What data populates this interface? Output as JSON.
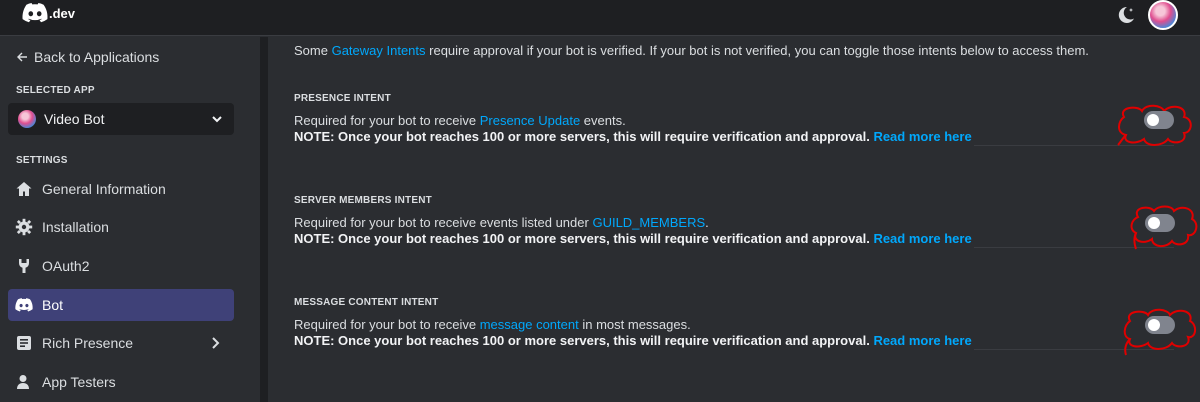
{
  "header": {
    "logo_text": ".dev"
  },
  "sidebar": {
    "back_label": "Back to Applications",
    "selected_app_title": "SELECTED APP",
    "selected_app_name": "Video Bot",
    "settings_title": "SETTINGS",
    "items": [
      {
        "label": "General Information",
        "icon": "home-icon"
      },
      {
        "label": "Installation",
        "icon": "gear-icon"
      },
      {
        "label": "OAuth2",
        "icon": "wrench-icon"
      },
      {
        "label": "Bot",
        "icon": "discord-bot-icon",
        "active": true
      },
      {
        "label": "Rich Presence",
        "icon": "document-icon",
        "has_submenu": true
      },
      {
        "label": "App Testers",
        "icon": "person-icon"
      }
    ]
  },
  "main": {
    "intro": {
      "prefix": "Some ",
      "link": "Gateway Intents",
      "suffix": " require approval if your bot is verified. If your bot is not verified, you can toggle those intents below to access them."
    },
    "intents": [
      {
        "title": "PRESENCE INTENT",
        "desc_prefix": "Required for your bot to receive ",
        "desc_link": "Presence Update",
        "desc_suffix": " events.",
        "note": "NOTE: Once your bot reaches 100 or more servers, this will require verification and approval.",
        "note_link": "Read more here",
        "enabled": false
      },
      {
        "title": "SERVER MEMBERS INTENT",
        "desc_prefix": "Required for your bot to receive events listed under ",
        "desc_link": "GUILD_MEMBERS",
        "desc_suffix": ".",
        "note": "NOTE: Once your bot reaches 100 or more servers, this will require verification and approval.",
        "note_link": "Read more here",
        "enabled": false
      },
      {
        "title": "MESSAGE CONTENT INTENT",
        "desc_prefix": "Required for your bot to receive ",
        "desc_link": "message content",
        "desc_suffix": " in most messages.",
        "note": "NOTE: Once your bot reaches 100 or more servers, this will require verification and approval.",
        "note_link": "Read more here",
        "enabled": false
      }
    ]
  },
  "colors": {
    "accent_link": "#00a8fc",
    "active_nav": "#3f4178",
    "annotation": "#e00000"
  }
}
